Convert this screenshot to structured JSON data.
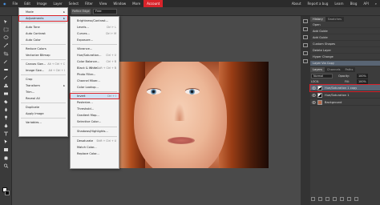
{
  "menubar": {
    "items": [
      "File",
      "Edit",
      "Image",
      "Layer",
      "Select",
      "Filter",
      "View",
      "Window",
      "More",
      "Account"
    ],
    "right": [
      "About",
      "Report a bug",
      "Learn",
      "Blog",
      "API"
    ]
  },
  "options": {
    "refine_label": "Refine Edge",
    "mode_value": "Free"
  },
  "image_menu": {
    "items": [
      {
        "label": "Mode",
        "shortcut": "",
        "arrow": true
      },
      {
        "label": "Adjustments",
        "shortcut": "",
        "arrow": true
      },
      {
        "label": "Auto Tone",
        "shortcut": "",
        "arrow": false
      },
      {
        "label": "Auto Contrast",
        "shortcut": "",
        "arrow": false
      },
      {
        "label": "Auto Color",
        "shortcut": "",
        "arrow": false
      },
      {
        "label": "Reduce Colors",
        "shortcut": "",
        "arrow": false
      },
      {
        "label": "Vectorize Bitmap",
        "shortcut": "",
        "arrow": false
      },
      {
        "label": "Canvas Size...",
        "shortcut": "Alt + Ctrl + C",
        "arrow": false
      },
      {
        "label": "Image Size...",
        "shortcut": "Alt + Ctrl + I",
        "arrow": false
      },
      {
        "label": "Crop",
        "shortcut": "",
        "arrow": false
      },
      {
        "label": "Transform",
        "shortcut": "",
        "arrow": true
      },
      {
        "label": "Trim...",
        "shortcut": "",
        "arrow": false
      },
      {
        "label": "Reveal All",
        "shortcut": "",
        "arrow": false
      },
      {
        "label": "Duplicate",
        "shortcut": "",
        "arrow": false
      },
      {
        "label": "Apply Image",
        "shortcut": "",
        "arrow": false
      },
      {
        "label": "Variables...",
        "shortcut": "",
        "arrow": false
      }
    ]
  },
  "adjustments_menu": {
    "items": [
      {
        "label": "Brightness/Contrast...",
        "shortcut": ""
      },
      {
        "label": "Levels...",
        "shortcut": "Ctrl + L"
      },
      {
        "label": "Curves...",
        "shortcut": "Ctrl + M"
      },
      {
        "label": "Exposure...",
        "shortcut": ""
      },
      {
        "label": "Vibrance...",
        "shortcut": ""
      },
      {
        "label": "Hue/Saturation...",
        "shortcut": "Ctrl + U"
      },
      {
        "label": "Color Balance...",
        "shortcut": "Ctrl + B"
      },
      {
        "label": "Black & White...",
        "shortcut": "Alt + Shift + Ctrl + B"
      },
      {
        "label": "Photo Filter...",
        "shortcut": ""
      },
      {
        "label": "Channel Mixer...",
        "shortcut": ""
      },
      {
        "label": "Color Lookup...",
        "shortcut": ""
      },
      {
        "label": "Invert",
        "shortcut": "Ctrl + I"
      },
      {
        "label": "Posterize...",
        "shortcut": ""
      },
      {
        "label": "Threshold...",
        "shortcut": ""
      },
      {
        "label": "Gradient Map...",
        "shortcut": ""
      },
      {
        "label": "Selective Color...",
        "shortcut": ""
      },
      {
        "label": "Shadows/Highlights...",
        "shortcut": ""
      },
      {
        "label": "Desaturate",
        "shortcut": "Shift + Ctrl + U"
      },
      {
        "label": "Match Color...",
        "shortcut": ""
      },
      {
        "label": "Replace Color...",
        "shortcut": ""
      }
    ]
  },
  "history": {
    "tabs": [
      "History",
      "Swatches"
    ],
    "items": [
      "Open",
      "Add Guide",
      "Add Guide",
      "Custom Shapes",
      "Delete Layer",
      "Hyper Change",
      "Layer Via Copy"
    ]
  },
  "layers": {
    "tabs": [
      "Layers",
      "Channels",
      "Paths"
    ],
    "blend_mode": "Normal",
    "opacity_label": "Opacity:",
    "opacity_value": "100%",
    "lock_label": "LOCK:",
    "fill_label": "Fill:",
    "fill_value": "100%",
    "items": [
      "Hue/Saturation 1 copy",
      "Hue/Saturation 1",
      "Background"
    ]
  },
  "colors": {
    "accent": "#d8232a",
    "menu_bg": "#f4f4f4",
    "highlight": "#cfe1f4",
    "workspace": "#4a4a4a"
  }
}
